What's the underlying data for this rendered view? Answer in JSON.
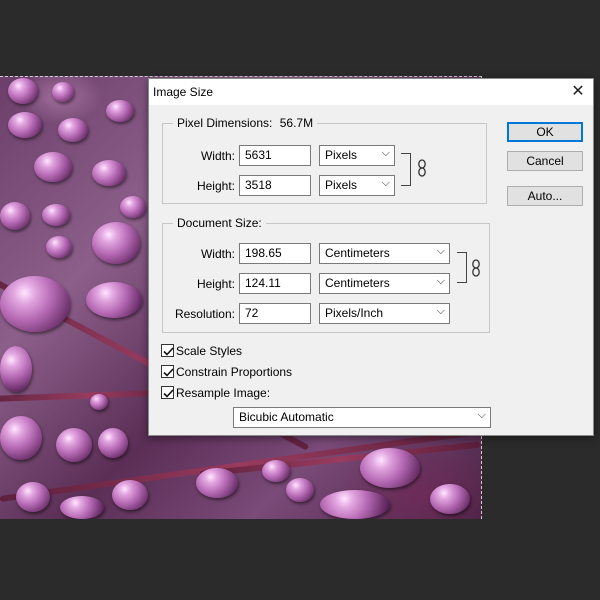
{
  "dialog": {
    "title": "Image Size",
    "close_glyph": "✕"
  },
  "pixel_dimensions": {
    "legend": "Pixel Dimensions:",
    "size": "56.7M",
    "width_label": "Width:",
    "width_value": "5631",
    "width_unit": "Pixels",
    "height_label": "Height:",
    "height_value": "3518",
    "height_unit": "Pixels"
  },
  "document_size": {
    "legend": "Document Size:",
    "width_label": "Width:",
    "width_value": "198.65",
    "width_unit": "Centimeters",
    "height_label": "Height:",
    "height_value": "124.11",
    "height_unit": "Centimeters",
    "resolution_label": "Resolution:",
    "resolution_value": "72",
    "resolution_unit": "Pixels/Inch"
  },
  "options": {
    "scale_styles": {
      "label": "Scale Styles",
      "checked": true
    },
    "constrain_proportions": {
      "label": "Constrain Proportions",
      "checked": true
    },
    "resample_image": {
      "label": "Resample Image:",
      "checked": true
    },
    "resample_method": "Bicubic Automatic"
  },
  "buttons": {
    "ok": "OK",
    "cancel": "Cancel",
    "auto": "Auto..."
  },
  "icons": {
    "chain": "chain-link-icon",
    "dropdown": "chevron-down-icon",
    "check": "checkmark-icon"
  },
  "colors": {
    "workspace": "#2b2b2b",
    "dialog_bg": "#f0f0f0",
    "default_button_border": "#0078d7"
  }
}
